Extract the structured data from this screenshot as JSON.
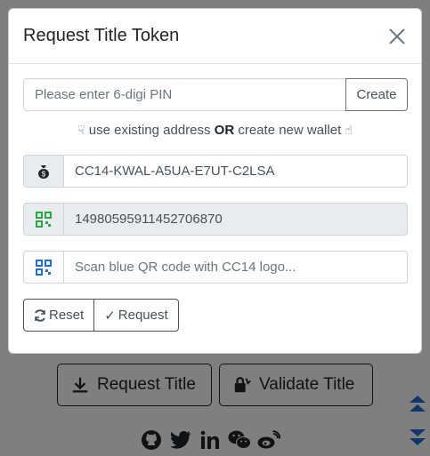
{
  "modal": {
    "title": "Request Title Token",
    "pin": {
      "placeholder": "Please enter 6-digi PIN",
      "create_label": "Create"
    },
    "hint": {
      "pre": "use existing address",
      "or": "OR",
      "post": "create new wallet"
    },
    "address": {
      "value": "CC14-KWAL-A5UA-E7UT-C2LSA",
      "icon": "money-bag-icon"
    },
    "token_id": {
      "value": "14980595911452706870",
      "icon": "qr-code-icon"
    },
    "scan": {
      "placeholder": "Scan blue QR code with CC14 logo...",
      "icon": "qr-code-icon"
    },
    "buttons": {
      "reset_label": "Reset",
      "request_label": "Request"
    }
  },
  "background": {
    "request_title_label": "Request Title",
    "validate_title_label": "Validate Title",
    "social_icons": [
      "github-icon",
      "twitter-icon",
      "linkedin-icon",
      "wechat-icon",
      "weibo-icon"
    ]
  },
  "colors": {
    "qr_green": "#28a745",
    "qr_blue": "#1e6fd9",
    "scroll_arrow": "#1e6fd9"
  }
}
